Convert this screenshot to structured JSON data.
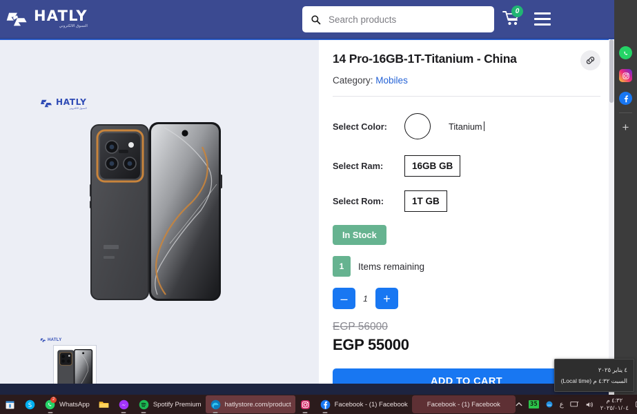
{
  "header": {
    "logo_name": "HATLY",
    "logo_sub": "التسوق الالكتروني",
    "logo_icon": "hatly-logo-icon",
    "search_placeholder": "Search products",
    "search_value": "",
    "search_icon": "search-icon",
    "cart_icon": "shopping-cart-icon",
    "cart_count": "0",
    "menu_icon": "hamburger-menu-icon",
    "bg_color": "#3b4a91"
  },
  "gallery": {
    "watermark_name": "HATLY",
    "watermark_sub": "التسوق الالكتروني",
    "main_image_alt": "xiaomi-14-pro-titanium-phone",
    "thumb_alt": "xiaomi-14-pro-thumbnail"
  },
  "product": {
    "title": "14 Pro-16GB-1T-Titanium - China",
    "link_icon": "chain-link-icon",
    "category_label": "Category:",
    "category_value": "Mobiles",
    "color_label": "Select Color:",
    "color_value": "Titanium",
    "color_swatch": "#ffffff",
    "ram_label": "Select Ram:",
    "ram_value": "16GB GB",
    "rom_label": "Select Rom:",
    "rom_value": "1T GB",
    "stock_badge": "In Stock",
    "stock_color": "#66b390",
    "remaining_count": "1",
    "remaining_label": "Items remaining",
    "qty_decrease": "–",
    "qty_value": "1",
    "qty_increase": "+",
    "old_price": "EGP 56000",
    "new_price": "EGP 55000",
    "add_to_cart": "ADD TO CART",
    "accent_color": "#1877f2"
  },
  "social_sidebar": {
    "items": [
      {
        "name": "whatsapp-icon",
        "color": "#25d366"
      },
      {
        "name": "instagram-icon",
        "color": "#c13584"
      },
      {
        "name": "facebook-icon",
        "color": "#1877f2"
      }
    ],
    "add_label": "+"
  },
  "taskbar": {
    "items": [
      {
        "icon": "microsoft-store-icon",
        "label": "",
        "state": "pinned"
      },
      {
        "icon": "skype-icon",
        "label": "",
        "state": "pinned"
      },
      {
        "icon": "whatsapp-icon",
        "label": "WhatsApp",
        "state": "running"
      },
      {
        "icon": "file-explorer-icon",
        "label": "",
        "state": "pinned"
      },
      {
        "icon": "messenger-icon",
        "label": "",
        "state": "running"
      },
      {
        "icon": "spotify-icon",
        "label": "Spotify Premium",
        "state": "running"
      },
      {
        "icon": "edge-icon",
        "label": "hatlystore.com/product",
        "state": "active"
      },
      {
        "icon": "instagram-icon",
        "label": "",
        "state": "running"
      },
      {
        "icon": "facebook-icon",
        "label": "Facebook - (1) Facebook",
        "state": "running"
      },
      {
        "icon": "facebook-window-icon",
        "label": "Facebook - (1) Facebook",
        "state": "focused"
      }
    ],
    "tray": {
      "overflow_icon": "chevron-up-icon",
      "battery_level": "35",
      "onedrive_icon": "onedrive-icon",
      "language": "ع",
      "network_icon": "network-icon",
      "volume_icon": "volume-icon",
      "clock_time": "٤:٣٢ م",
      "clock_date": "٢٠٢٥/٠١/٠٤",
      "notification_icon": "notification-icon"
    },
    "tooltip": {
      "line1": "٤ يناير ٢٠٢٥",
      "line2": "السبت ٤:٣٢ م (Local time)"
    }
  }
}
